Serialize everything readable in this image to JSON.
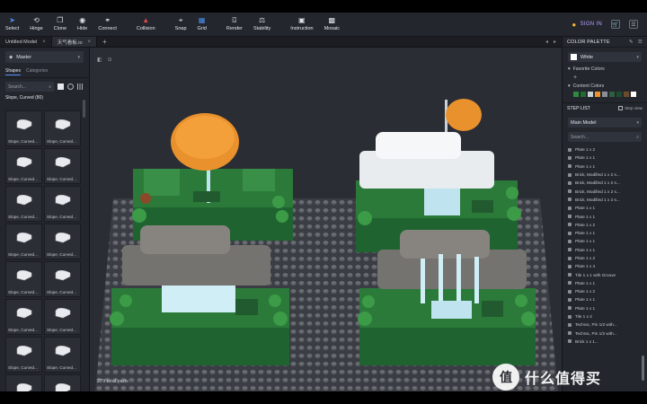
{
  "toolbar": {
    "items": [
      {
        "label": "Select",
        "icon": "cursor-icon"
      },
      {
        "label": "Hinge",
        "icon": "hinge-icon"
      },
      {
        "label": "Clone",
        "icon": "clone-icon"
      },
      {
        "label": "Hide",
        "icon": "eye-icon"
      },
      {
        "label": "Connect",
        "icon": "connect-icon"
      },
      {
        "label": "Collision",
        "icon": "collision-icon"
      },
      {
        "label": "Snap",
        "icon": "snap-icon"
      },
      {
        "label": "Grid",
        "icon": "grid-icon"
      },
      {
        "label": "Render",
        "icon": "camera-icon"
      },
      {
        "label": "Stability",
        "icon": "stability-icon"
      },
      {
        "label": "Instruction",
        "icon": "instruction-icon"
      },
      {
        "label": "Mosaic",
        "icon": "mosaic-icon"
      }
    ],
    "signin": "SIGN IN"
  },
  "tabs": [
    {
      "label": "Untitled Model"
    },
    {
      "label": "天气看板.io"
    }
  ],
  "left_panel": {
    "model": "Master",
    "tabs": [
      "Shapes",
      "Categories"
    ],
    "search_placeholder": "Search...",
    "category": "Slope, Curved (80)",
    "parts": [
      "Slope, Curved...",
      "Slope, Curved...",
      "Slope, Curved...",
      "Slope, Curved...",
      "Slope, Curved...",
      "Slope, Curved...",
      "Slope, Curved...",
      "Slope, Curved...",
      "Slope, Curved...",
      "Slope, Curved...",
      "Slope, Curved...",
      "Slope, Curved...",
      "Slope, Curved...",
      "Slope, Curved...",
      "Slope, Curved...",
      "Slope, Curved..."
    ]
  },
  "viewport": {
    "status": "279 total parts"
  },
  "right_panel": {
    "title": "COLOR PALETTE",
    "selected_color": "White",
    "favorite_colors": "Favorite Colors",
    "content_colors": "Content Colors",
    "swatches": [
      "#2d8a3e",
      "#1f6b33",
      "#c9cfd6",
      "#f0922b",
      "#8a8f97",
      "#2f5f3d",
      "#1b4d2e",
      "#6b4b2a",
      "#ffffff"
    ],
    "steplist_title": "STEP LIST",
    "step_view": "Step view",
    "model": "Main Model",
    "search_placeholder": "Search...",
    "steps": [
      "Plate 1 x 2",
      "Plate 1 x 1",
      "Plate 1 x 1",
      "Brick, Modified 1 x 2 s...",
      "Brick, Modified 1 x 2 s...",
      "Brick, Modified 1 x 2 s...",
      "Brick, Modified 1 x 2 s...",
      "Plate 1 x 1",
      "Plate 1 x 1",
      "Plate 1 x 2",
      "Plate 1 x 1",
      "Plate 1 x 1",
      "Plate 1 x 1",
      "Plate 1 x 2",
      "Plate 1 x 4",
      "Tile 1 x 1 with Groove",
      "Plate 1 x 1",
      "Plate 1 x 2",
      "Plate 1 x 1",
      "Plate 1 x 1",
      "Tile 1 x 2",
      "Technic, Pin 1/2 with...",
      "Technic, Pin 1/2 with...",
      "Brick 1 x 1..."
    ]
  },
  "watermark": {
    "icon_text": "值",
    "text": "什么值得买"
  }
}
